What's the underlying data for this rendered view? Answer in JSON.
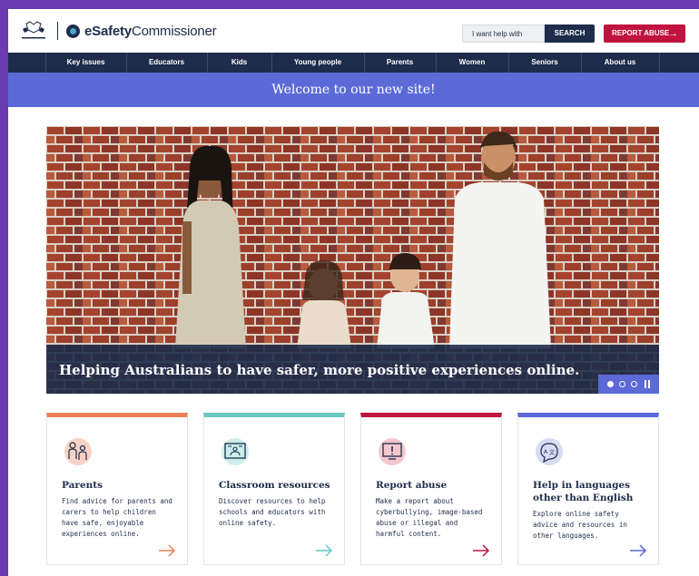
{
  "header": {
    "crest_label": "Australian Government",
    "logo_bold": "eSafety",
    "logo_regular": "Commissioner",
    "search_placeholder": "I want help with",
    "search_button": "SEARCH",
    "report_button": "REPORT ABUSE"
  },
  "nav": {
    "items": [
      "Key issues",
      "Educators",
      "Kids",
      "Young people",
      "Parents",
      "Women",
      "Seniors",
      "About us"
    ]
  },
  "banner": {
    "text": "Welcome to our new site!"
  },
  "hero": {
    "caption": "Helping Australians to have safer, more positive experiences online.",
    "slide_count": 3,
    "active_slide": 1
  },
  "cards": [
    {
      "title": "Parents",
      "description": "Find advice for parents and carers to help children have safe, enjoyable experiences online.",
      "accent": "#e8825a",
      "icon": "family-icon"
    },
    {
      "title": "Classroom resources",
      "description": "Discover resources to help schools and educators with online safety.",
      "accent": "#67c7c3",
      "icon": "presentation-board-icon"
    },
    {
      "title": "Report abuse",
      "description": "Make a report about cyberbullying, image-based abuse or illegal and harmful content.",
      "accent": "#c0133f",
      "icon": "warning-screen-icon"
    },
    {
      "title": "Help in languages other than English",
      "description": "Explore online safety advice and resources in other languages.",
      "accent": "#5b6ad7",
      "icon": "translate-speech-icon"
    }
  ],
  "colors": {
    "navy": "#1d2c4a",
    "brand_purple": "#5b6ad7",
    "report_red": "#c0133f",
    "page_border": "#6b3bb0"
  }
}
